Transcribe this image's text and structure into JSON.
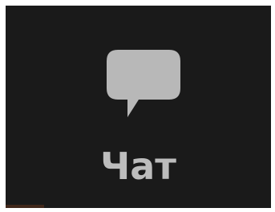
{
  "toolbar": {
    "chat": {
      "label": "Чат",
      "icon": "chat-bubble-icon"
    }
  },
  "colors": {
    "background": "#1a1a1a",
    "icon": "#b8b8b8",
    "label": "#bdbdbd"
  }
}
